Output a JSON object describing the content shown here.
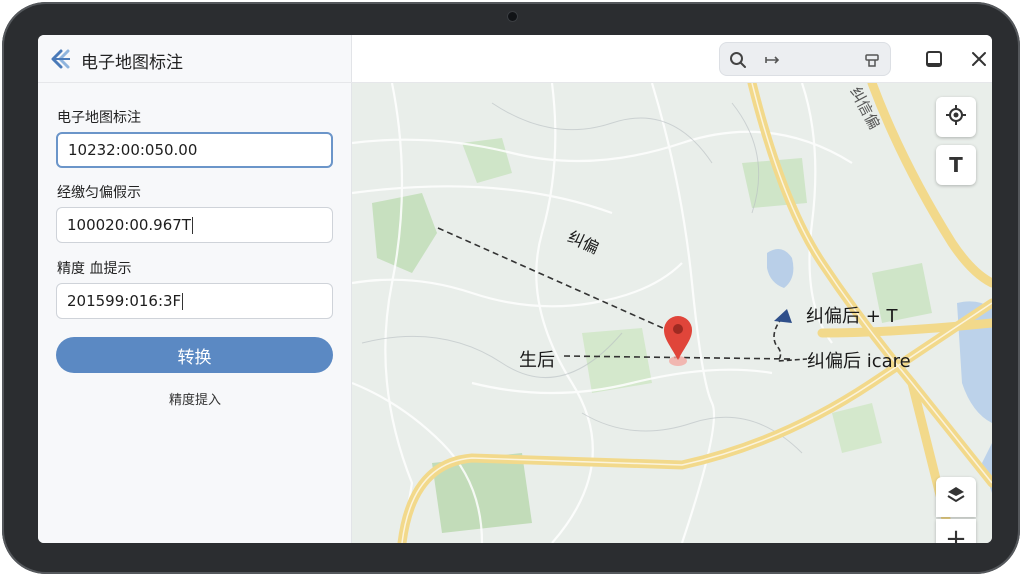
{
  "app": {
    "title": "电子地图标注",
    "logo_icon": "double-arrow-logo-icon"
  },
  "form": {
    "fields": [
      {
        "label": "电子地图标注",
        "value": "10232:00:050.00"
      },
      {
        "label": "经缴匀偏假示",
        "value": "100020:00.967T"
      },
      {
        "label": "精度 血提示",
        "value": "201599:016:3F"
      }
    ],
    "convert_button": "转换",
    "sub_link": "精度提入"
  },
  "toolbar": {
    "icons": [
      "search-icon",
      "expand-arrow-icon",
      "lock-icon",
      "window-icon",
      "close-icon"
    ]
  },
  "map": {
    "road_name": "纠信偏",
    "labels": {
      "diagonal": "纠偏",
      "left": "生后",
      "right_top": "纠偏后 + T",
      "right_bottom": "纠偏后 icare"
    },
    "controls": {
      "locate": "locate-icon",
      "text": "T",
      "layers": "layers-icon",
      "zoom_in": "+"
    },
    "colors": {
      "pin": "#e0453a",
      "road": "#f4dc8a",
      "park": "#b8dab0"
    }
  }
}
